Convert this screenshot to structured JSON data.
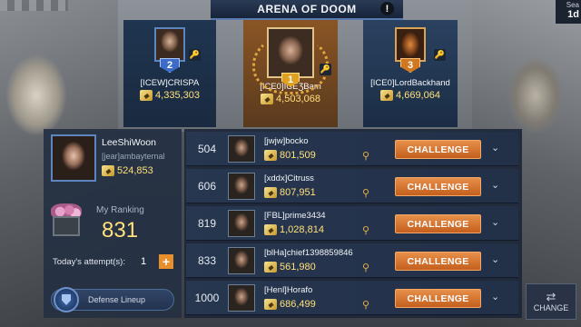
{
  "header": {
    "title": "ARENA OF DOOM",
    "info_icon": "!",
    "season_label": "Sea",
    "season_value": "1d"
  },
  "podium": [
    {
      "rank": "2",
      "name": "[ICEW]CRISPA",
      "power": "4,335,303"
    },
    {
      "rank": "1",
      "name": "[ICE0]ICEƷBam",
      "power": "4,503,068"
    },
    {
      "rank": "3",
      "name": "[ICE0]LordBackhand",
      "power": "4,669,064"
    }
  ],
  "player": {
    "name": "LeeShiWoon",
    "guild": "[jear]ambayternal",
    "power": "524,853",
    "ranking_label": "My Ranking",
    "ranking_value": "831",
    "attempts_label": "Today's attempt(s):",
    "attempts_value": "1",
    "plus_label": "+",
    "defense_label": "Defense Lineup"
  },
  "opponents": [
    {
      "rank": "504",
      "name": "[jwjw]bocko",
      "power": "801,509",
      "action": "CHALLENGE"
    },
    {
      "rank": "606",
      "name": "[xddx]Citruss",
      "power": "807,951",
      "action": "CHALLENGE"
    },
    {
      "rank": "819",
      "name": "[FBL]prime3434",
      "power": "1,028,814",
      "action": "CHALLENGE"
    },
    {
      "rank": "833",
      "name": "[blHa]chief1398859846",
      "power": "561,980",
      "action": "CHALLENGE"
    },
    {
      "rank": "1000",
      "name": "[Henl]Horafo",
      "power": "686,499",
      "action": "CHALLENGE"
    }
  ],
  "change_button": {
    "label": "CHANGE",
    "icon": "refresh-icon"
  },
  "colors": {
    "accent_orange": "#d8742e",
    "power_gold": "#ffe07a",
    "panel_navy": "#233048"
  }
}
